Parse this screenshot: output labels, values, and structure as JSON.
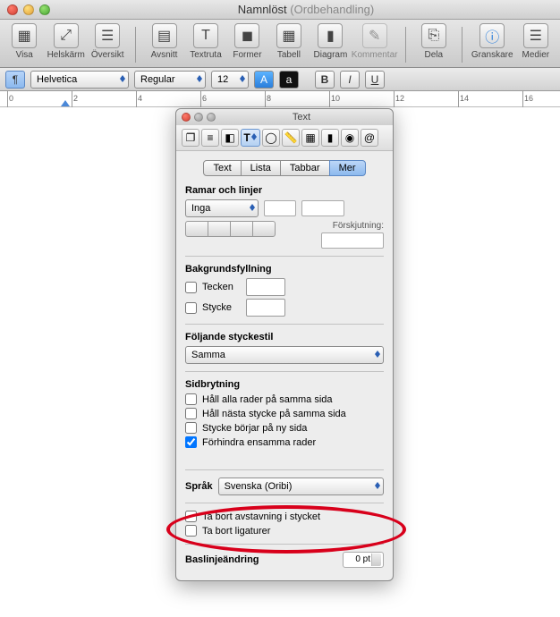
{
  "window": {
    "title": "Namnlöst",
    "subtitle": "(Ordbehandling)"
  },
  "toolbar": {
    "items": [
      {
        "label": "Visa"
      },
      {
        "label": "Helskärm"
      },
      {
        "label": "Översikt"
      },
      {
        "label": "Avsnitt"
      },
      {
        "label": "Textruta"
      },
      {
        "label": "Former"
      },
      {
        "label": "Tabell"
      },
      {
        "label": "Diagram"
      },
      {
        "label": "Kommentar"
      },
      {
        "label": "Dela"
      },
      {
        "label": "Granskare"
      },
      {
        "label": "Medier"
      }
    ]
  },
  "format": {
    "style_btn": "¶",
    "font": "Helvetica",
    "weight": "Regular",
    "size": "12",
    "a_label": "a",
    "bold": "B",
    "italic": "I",
    "underline": "U"
  },
  "ruler": {
    "ticks": [
      "0",
      "2",
      "4",
      "6",
      "8",
      "10",
      "12",
      "14",
      "16"
    ]
  },
  "inspector": {
    "title": "Text",
    "tabs": {
      "text": "Text",
      "list": "Lista",
      "tabs": "Tabbar",
      "more": "Mer"
    },
    "frames": {
      "title": "Ramar och linjer",
      "style": "Inga",
      "offset_label": "Förskjutning:"
    },
    "bg": {
      "title": "Bakgrundsfyllning",
      "char": "Tecken",
      "para": "Stycke"
    },
    "following": {
      "title": "Följande styckestil",
      "value": "Samma"
    },
    "pagebreak": {
      "title": "Sidbrytning",
      "keep_lines": "Håll alla rader på samma sida",
      "keep_next": "Håll nästa stycke på samma sida",
      "start_new": "Stycke börjar på ny sida",
      "widow": "Förhindra ensamma rader"
    },
    "language": {
      "label": "Språk",
      "value": "Svenska (Oribi)"
    },
    "hyphen": {
      "remove_hyph": "Ta bort avstavning i stycket",
      "remove_lig": "Ta bort ligaturer"
    },
    "baseline": {
      "label": "Baslinjeändring",
      "value": "0 pt"
    }
  }
}
